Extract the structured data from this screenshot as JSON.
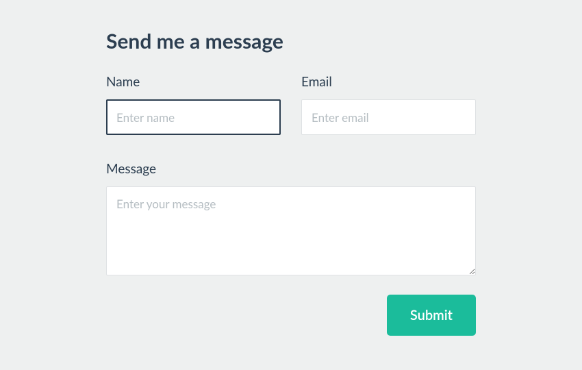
{
  "form": {
    "title": "Send me a message",
    "name_label": "Name",
    "name_placeholder": "Enter name",
    "name_value": "",
    "email_label": "Email",
    "email_placeholder": "Enter email",
    "email_value": "",
    "message_label": "Message",
    "message_placeholder": "Enter your message",
    "message_value": "",
    "submit_label": "Submit"
  },
  "colors": {
    "background": "#eef0f0",
    "text": "#2c3e50",
    "placeholder": "#b5bdc2",
    "input_border": "#dfe2e4",
    "focus_border": "#2c3e50",
    "accent": "#1bbc9b",
    "button_text": "#ffffff"
  }
}
